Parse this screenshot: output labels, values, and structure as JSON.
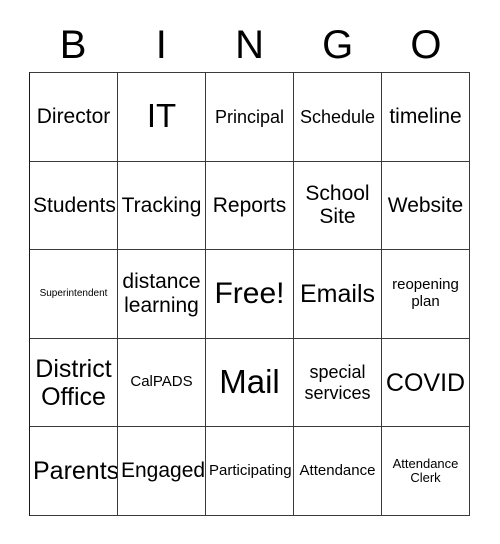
{
  "card": {
    "title": "BINGO Card",
    "header_letters": [
      "B",
      "I",
      "N",
      "G",
      "O"
    ],
    "grid_size": "5x5",
    "free_space_label": "Free!",
    "colors": {
      "background": "#ffffff",
      "text": "#000000",
      "grid_line": "#3a3a3a"
    },
    "rows": [
      [
        {
          "label": "Director",
          "size": "md"
        },
        {
          "label": "IT",
          "size": "xxl"
        },
        {
          "label": "Principal",
          "size": "sm"
        },
        {
          "label": "Schedule",
          "size": "sm"
        },
        {
          "label": "timeline",
          "size": "md"
        }
      ],
      [
        {
          "label": "Students",
          "size": "md"
        },
        {
          "label": "Tracking",
          "size": "md"
        },
        {
          "label": "Reports",
          "size": "md"
        },
        {
          "label": "School\nSite",
          "size": "md"
        },
        {
          "label": "Website",
          "size": "md"
        }
      ],
      [
        {
          "label": "Superintendent",
          "size": "tiny"
        },
        {
          "label": "distance\nlearning",
          "size": "md"
        },
        {
          "label": "Free!",
          "size": "xl"
        },
        {
          "label": "Emails",
          "size": "lg"
        },
        {
          "label": "reopening\nplan",
          "size": "xs"
        }
      ],
      [
        {
          "label": "District\nOffice",
          "size": "lg"
        },
        {
          "label": "CalPADS",
          "size": "xs"
        },
        {
          "label": "Mail",
          "size": "xxl"
        },
        {
          "label": "special\nservices",
          "size": "sm"
        },
        {
          "label": "COVID",
          "size": "lg"
        }
      ],
      [
        {
          "label": "Parents",
          "size": "lg"
        },
        {
          "label": "Engaged",
          "size": "md"
        },
        {
          "label": "Participating",
          "size": "xs"
        },
        {
          "label": "Attendance",
          "size": "xs"
        },
        {
          "label": "Attendance\nClerk",
          "size": "xxs"
        }
      ]
    ]
  }
}
